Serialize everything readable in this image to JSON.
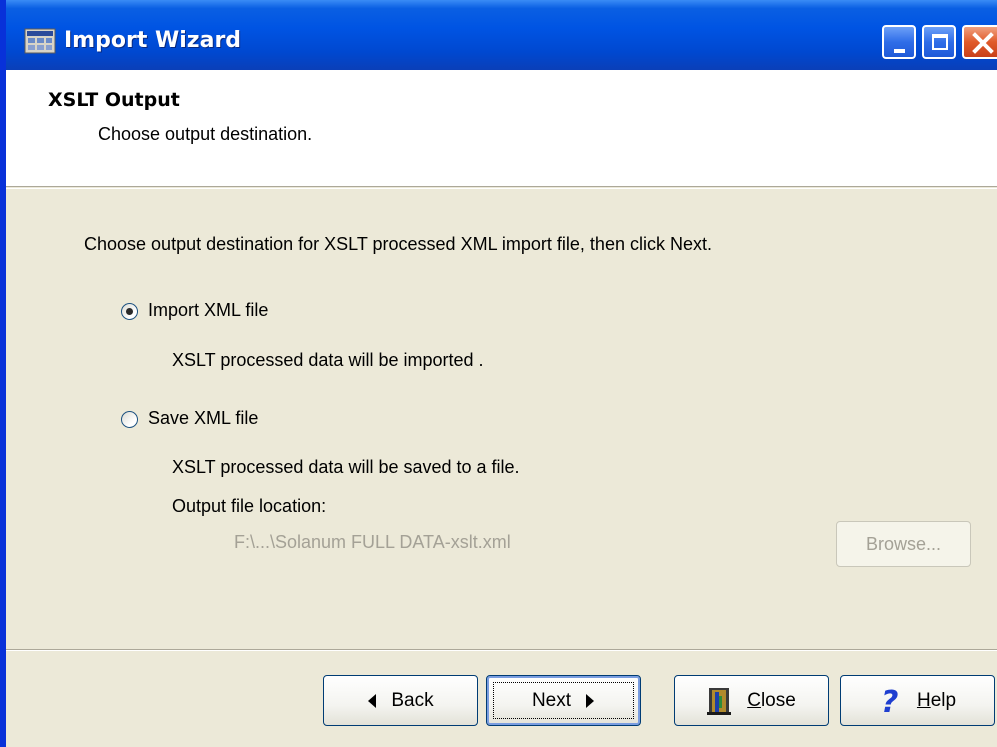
{
  "window": {
    "title": "Import Wizard"
  },
  "header": {
    "title": "XSLT Output",
    "subtitle": "Choose output destination."
  },
  "body": {
    "instruction": "Choose output destination for XSLT processed XML import file, then click Next.",
    "options": [
      {
        "label": "Import XML file",
        "description": "XSLT processed data will be imported .",
        "selected": true
      },
      {
        "label": "Save XML file",
        "description": "XSLT processed data will be saved to a file.",
        "selected": false
      }
    ],
    "output_location_label": "Output file location:",
    "output_path": "F:\\...\\Solanum FULL DATA-xslt.xml",
    "browse_label": "Browse..."
  },
  "buttons": {
    "back": {
      "label": "Back",
      "icon": "left-triangle-icon"
    },
    "next": {
      "label": "Next",
      "icon": "right-triangle-icon"
    },
    "close": {
      "label_prefix": "",
      "mnemonic": "C",
      "label_rest": "lose",
      "icon": "door-exit-icon"
    },
    "help": {
      "mnemonic": "H",
      "label_rest": "elp",
      "icon": "question-mark-icon"
    }
  },
  "colors": {
    "titlebar": "#0054e3",
    "dialog_bg": "#ece9d8",
    "disabled_text": "#a4a196",
    "close_button": "#e05a2a"
  }
}
